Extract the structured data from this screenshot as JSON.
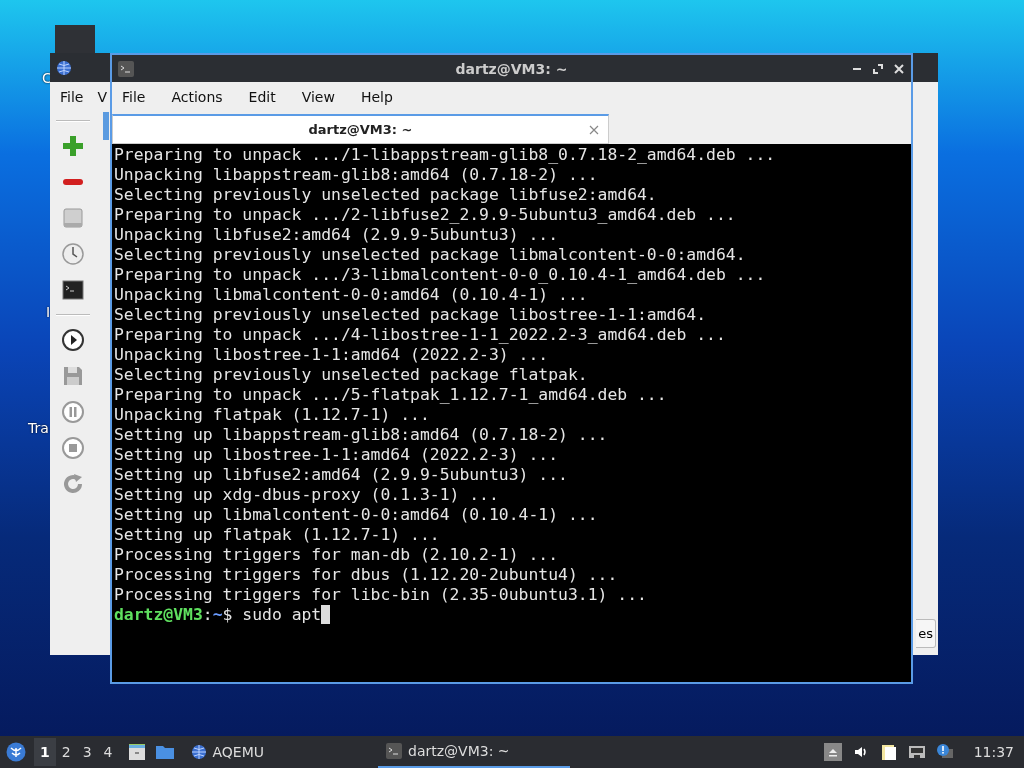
{
  "desktop_labels": [
    {
      "text": "C"
    },
    {
      "text": "I"
    },
    {
      "text": "Tra"
    }
  ],
  "back_window": {
    "menu": [
      "File",
      "V"
    ],
    "button_text": "es"
  },
  "terminal": {
    "title": "dartz@VM3: ~",
    "menu": [
      "File",
      "Actions",
      "Edit",
      "View",
      "Help"
    ],
    "tabs": [
      {
        "label": "dartz@VM3: ~",
        "selected": true
      }
    ],
    "lines": [
      "Preparing to unpack .../1-libappstream-glib8_0.7.18-2_amd64.deb ...",
      "Unpacking libappstream-glib8:amd64 (0.7.18-2) ...",
      "Selecting previously unselected package libfuse2:amd64.",
      "Preparing to unpack .../2-libfuse2_2.9.9-5ubuntu3_amd64.deb ...",
      "Unpacking libfuse2:amd64 (2.9.9-5ubuntu3) ...",
      "Selecting previously unselected package libmalcontent-0-0:amd64.",
      "Preparing to unpack .../3-libmalcontent-0-0_0.10.4-1_amd64.deb ...",
      "Unpacking libmalcontent-0-0:amd64 (0.10.4-1) ...",
      "Selecting previously unselected package libostree-1-1:amd64.",
      "Preparing to unpack .../4-libostree-1-1_2022.2-3_amd64.deb ...",
      "Unpacking libostree-1-1:amd64 (2022.2-3) ...",
      "Selecting previously unselected package flatpak.",
      "Preparing to unpack .../5-flatpak_1.12.7-1_amd64.deb ...",
      "Unpacking flatpak (1.12.7-1) ...",
      "Setting up libappstream-glib8:amd64 (0.7.18-2) ...",
      "Setting up libostree-1-1:amd64 (2022.2-3) ...",
      "Setting up libfuse2:amd64 (2.9.9-5ubuntu3) ...",
      "Setting up xdg-dbus-proxy (0.1.3-1) ...",
      "Setting up libmalcontent-0-0:amd64 (0.10.4-1) ...",
      "Setting up flatpak (1.12.7-1) ...",
      "Processing triggers for man-db (2.10.2-1) ...",
      "Processing triggers for dbus (1.12.20-2ubuntu4) ...",
      "Processing triggers for libc-bin (2.35-0ubuntu3.1) ..."
    ],
    "prompt": {
      "user_host": "dartz@VM3",
      "separator": ":",
      "path": "~",
      "symbol": "$",
      "command": "sudo apt"
    }
  },
  "taskbar": {
    "workspaces": [
      {
        "label": "1",
        "selected": true
      },
      {
        "label": "2",
        "selected": false
      },
      {
        "label": "3",
        "selected": false
      },
      {
        "label": "4",
        "selected": false
      }
    ],
    "tasks": [
      {
        "label": "AQEMU",
        "kind": "globe",
        "active": false
      },
      {
        "label": "dartz@VM3: ~",
        "kind": "terminal",
        "active": true
      }
    ],
    "clock": "11:37"
  }
}
